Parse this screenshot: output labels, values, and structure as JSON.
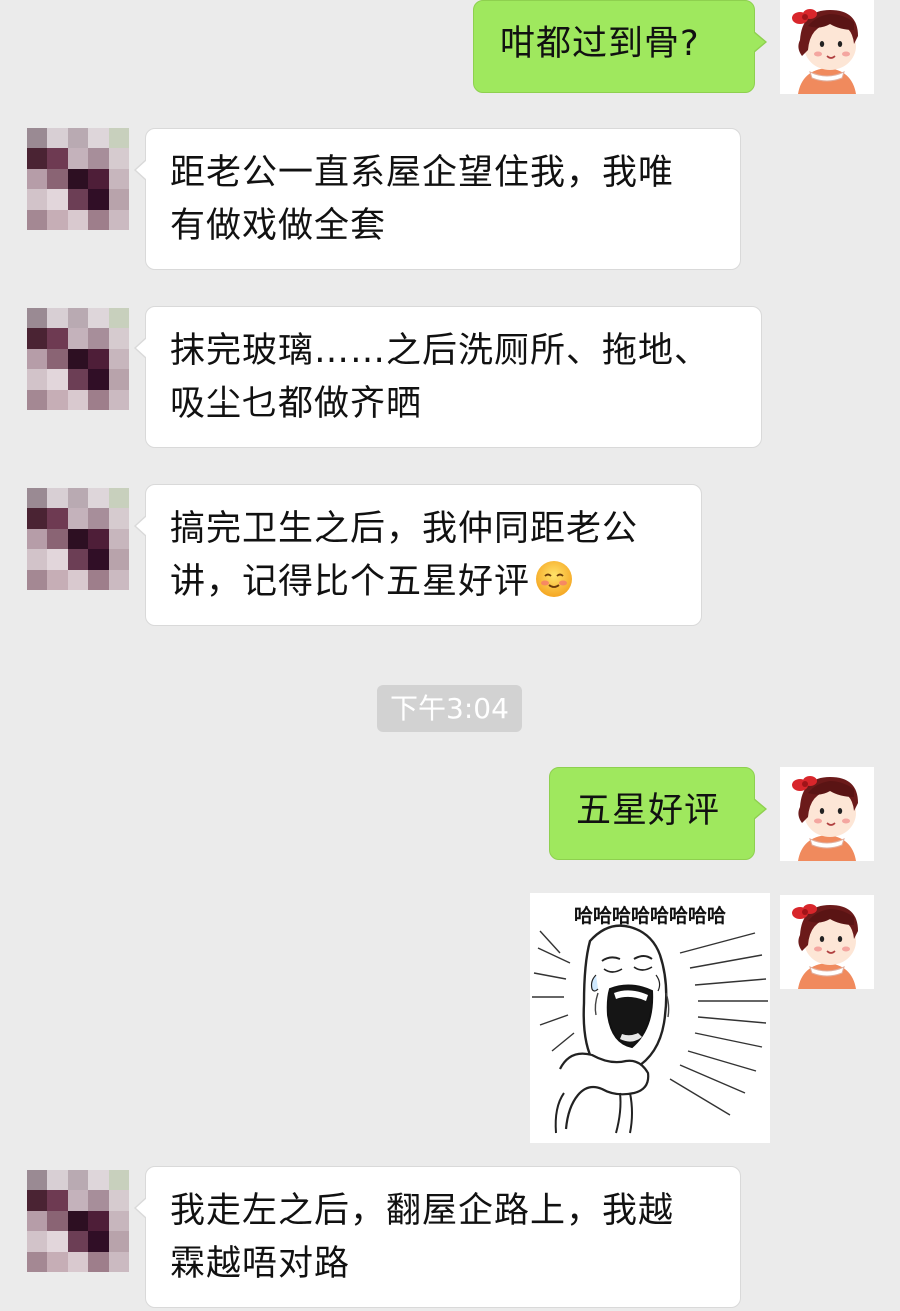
{
  "messages": [
    {
      "side": "right",
      "lines": [
        "咁都过到骨?"
      ]
    },
    {
      "side": "left",
      "lines": [
        "距老公一直系屋企望住我，我唯",
        "有做戏做全套"
      ]
    },
    {
      "side": "left",
      "lines": [
        "抹完玻璃……之后洗厕所、拖地、",
        "吸尘乜都做齐晒"
      ]
    },
    {
      "side": "left",
      "lines": [
        "搞完卫生之后，我仲同距老公",
        "讲，记得比个五星好评"
      ],
      "emoji": "blush-smile-icon"
    },
    {
      "side": "right",
      "lines": [
        "五星好评"
      ]
    },
    {
      "side": "right",
      "type": "sticker",
      "caption": "哈哈哈哈哈哈哈哈"
    },
    {
      "side": "left",
      "lines": [
        "我走左之后，翻屋企路上，我越",
        "霖越唔对路"
      ]
    }
  ],
  "timestamp": "下午3:04",
  "colors": {
    "background": "#ebebeb",
    "self_bubble": "#9fe85e",
    "other_bubble": "#ffffff",
    "timestamp_pill": "#d2d2d2"
  },
  "icons": {
    "self_avatar": "girl-avatar-icon",
    "other_avatar": "pixelated-avatar-icon"
  }
}
